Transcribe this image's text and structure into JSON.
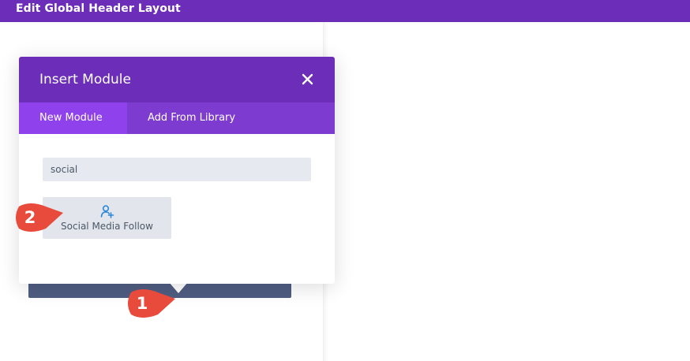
{
  "window": {
    "title": "Edit Global Header Layout"
  },
  "modal": {
    "title": "Insert Module",
    "close_icon": "close-icon",
    "tabs": [
      {
        "label": "New Module",
        "active": true
      },
      {
        "label": "Add From Library",
        "active": false
      }
    ],
    "search": {
      "value": "social"
    },
    "modules": [
      {
        "label": "Social Media Follow",
        "icon": "user-plus-icon"
      }
    ]
  },
  "callouts": [
    {
      "number": "1"
    },
    {
      "number": "2"
    }
  ],
  "colors": {
    "header": "#6c2eb9",
    "tabs_bg": "#7e3bd0",
    "tab_active": "#8f42ec",
    "callout": "#e84b3c",
    "row_bar": "#4f5d82"
  }
}
